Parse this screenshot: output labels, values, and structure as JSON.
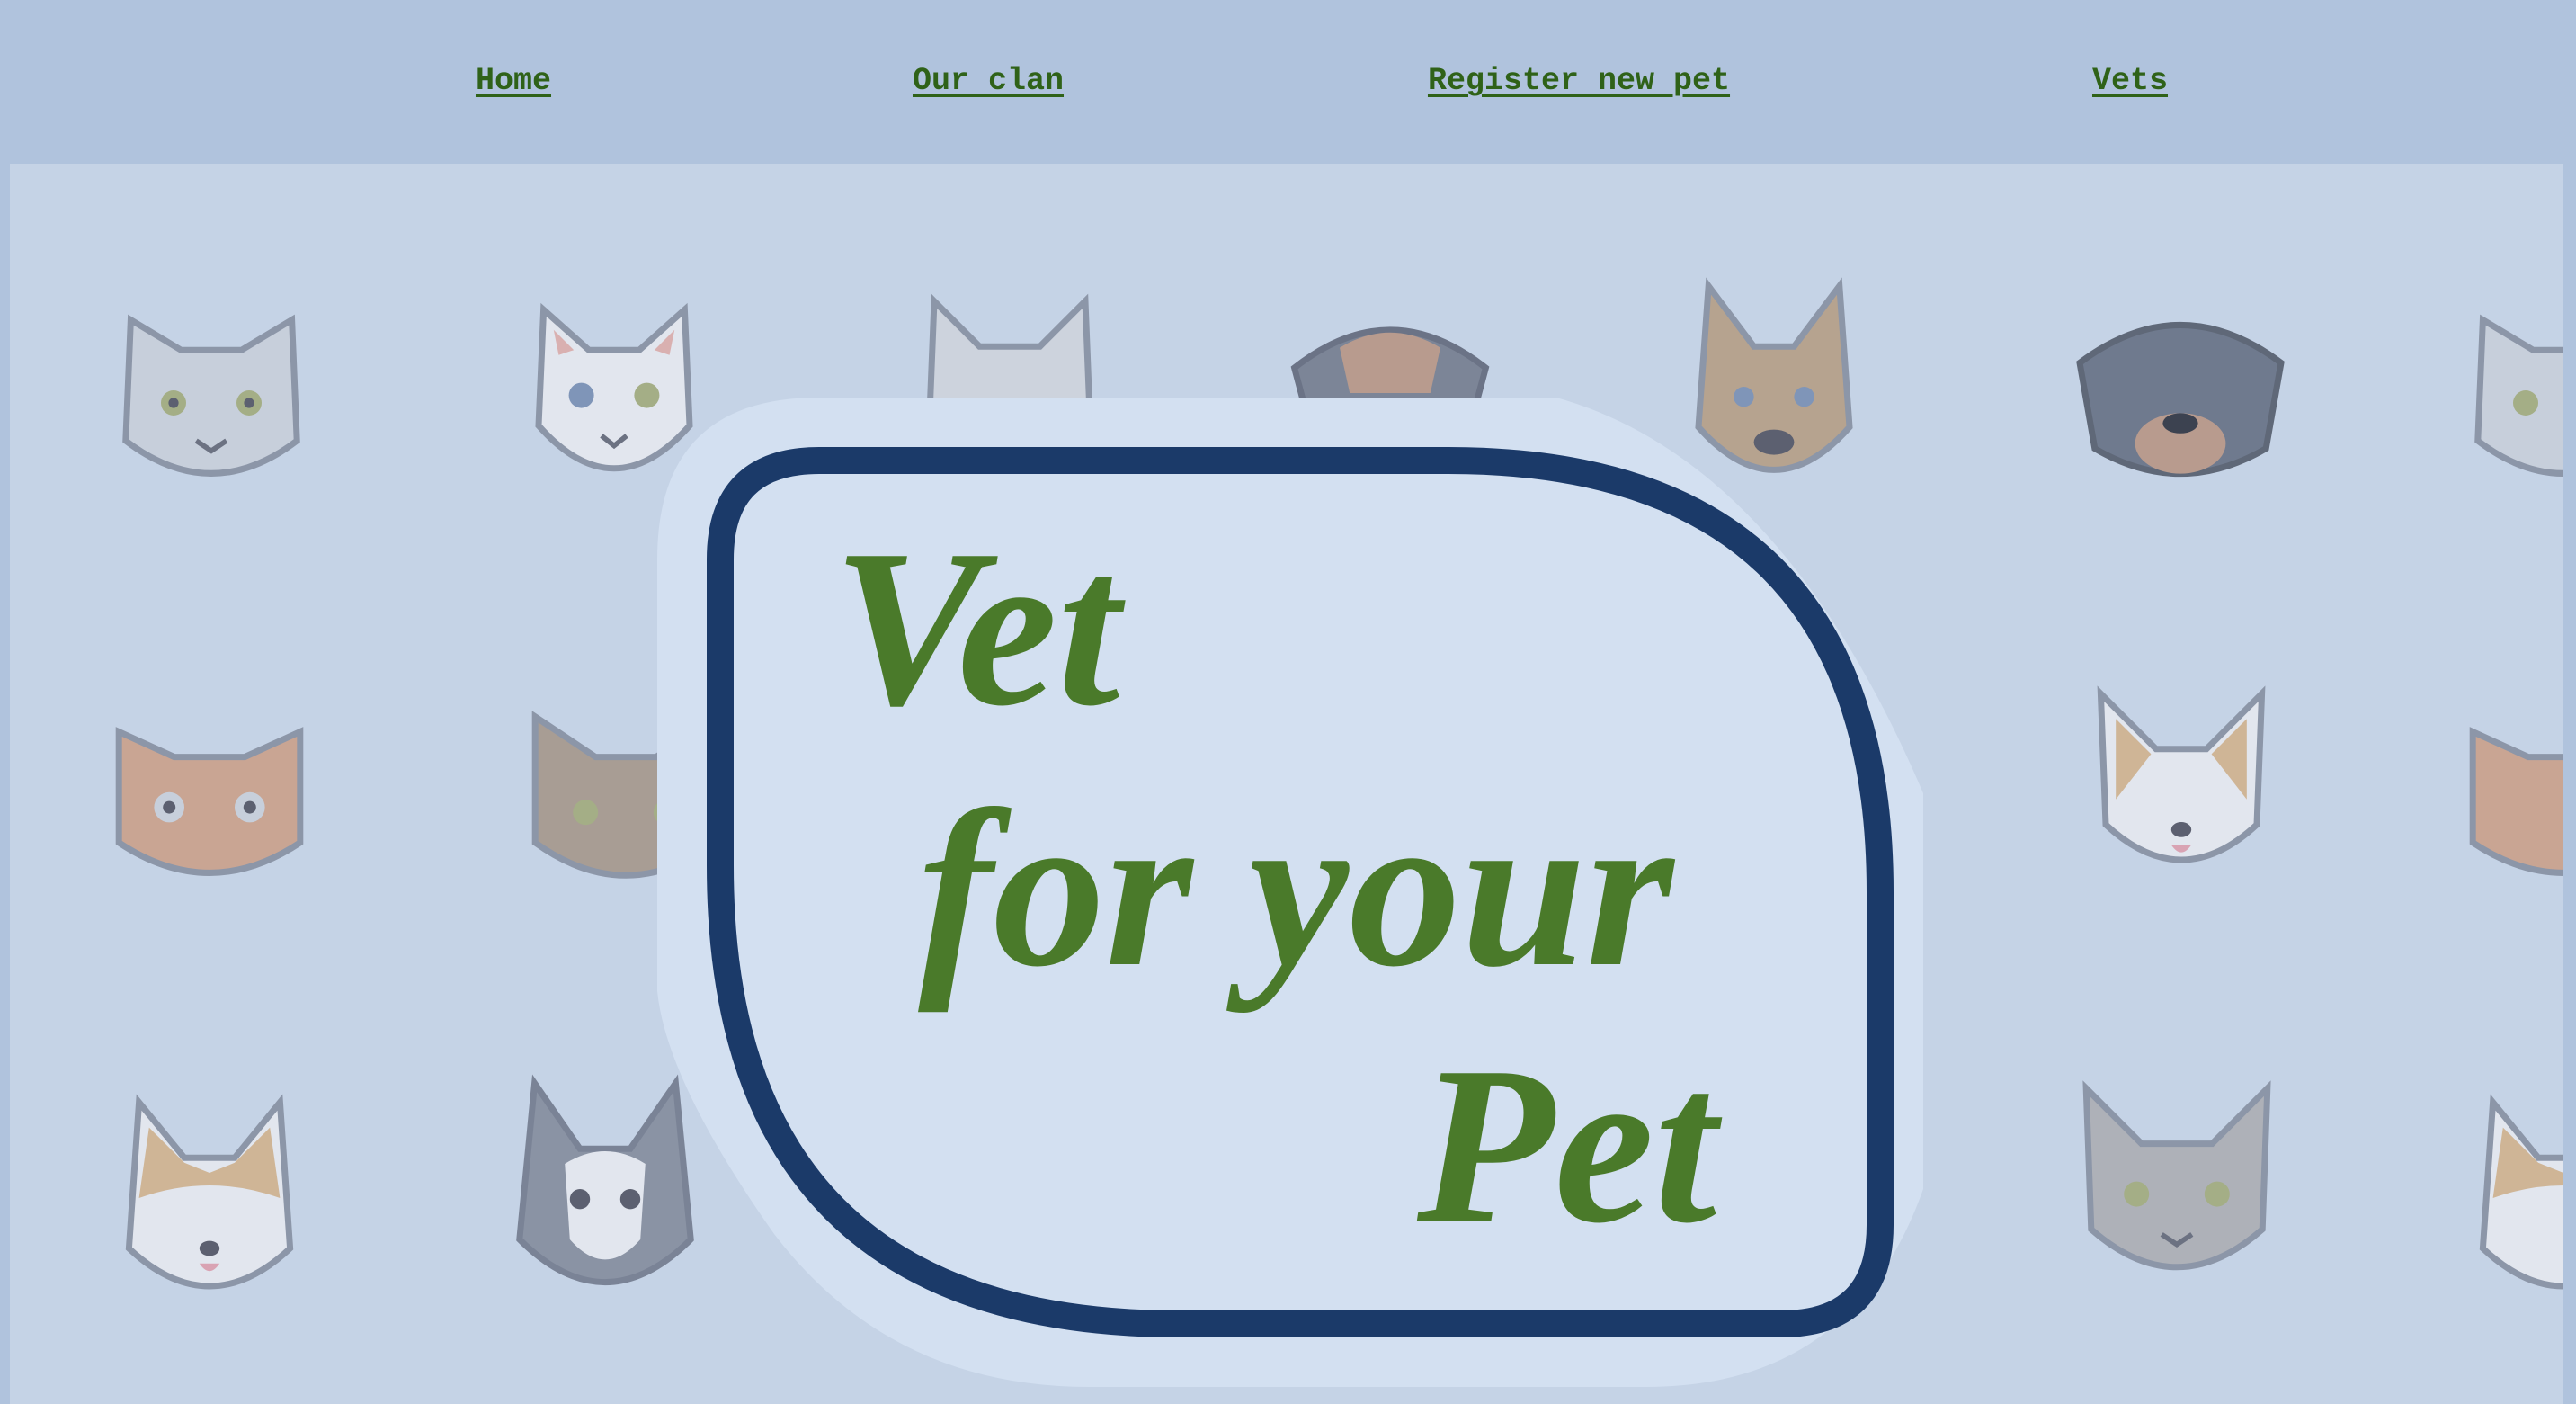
{
  "nav": {
    "links": [
      {
        "label": "Home"
      },
      {
        "label": "Our clan"
      },
      {
        "label": "Register new pet"
      },
      {
        "label": "Vets"
      }
    ]
  },
  "logo": {
    "line1": "Vet",
    "line2": "for your",
    "line3": "Pet"
  },
  "colors": {
    "nav_bg": "#b0c3dd",
    "hero_bg": "#c5d3e6",
    "link": "#2f6218",
    "logo_text": "#4a7a2a",
    "logo_border": "#1b3a69"
  }
}
